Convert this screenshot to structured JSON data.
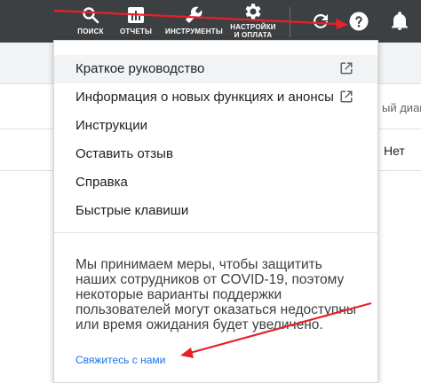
{
  "toolbar": {
    "search_label": "ПОИСК",
    "reports_label": "ОТЧЕТЫ",
    "tools_label": "ИНСТРУМЕНТЫ",
    "settings_label_line1": "НАСТРОЙКИ",
    "settings_label_line2": "И ОПЛАТА",
    "search_icon": "search-icon",
    "reports_icon": "bar-chart-icon",
    "tools_icon": "wrench-icon",
    "settings_icon": "gear-icon",
    "refresh_icon": "refresh-icon",
    "help_icon": "help-icon",
    "notifications_icon": "bell-icon"
  },
  "background": {
    "range_text": "ый диапа",
    "no_text": "Нет"
  },
  "help_menu": {
    "items": [
      {
        "label": "Краткое руководство",
        "external": true
      },
      {
        "label": "Информация о новых функциях и анонсы",
        "external": true
      },
      {
        "label": "Инструкции",
        "external": false
      },
      {
        "label": "Оставить отзыв",
        "external": false
      },
      {
        "label": "Справка",
        "external": false
      },
      {
        "label": "Быстрые клавиши",
        "external": false
      }
    ],
    "notice": "Мы принимаем меры, чтобы защитить наших сотрудников от COVID-19, поэтому некоторые варианты поддержки пользователей могут оказаться недоступны или время ожидания будет увеличено.",
    "contact_link": "Свяжитесь с нами"
  },
  "colors": {
    "toolbar_bg": "#3c4043",
    "link": "#1a73e8",
    "annotation": "#e8202a"
  }
}
